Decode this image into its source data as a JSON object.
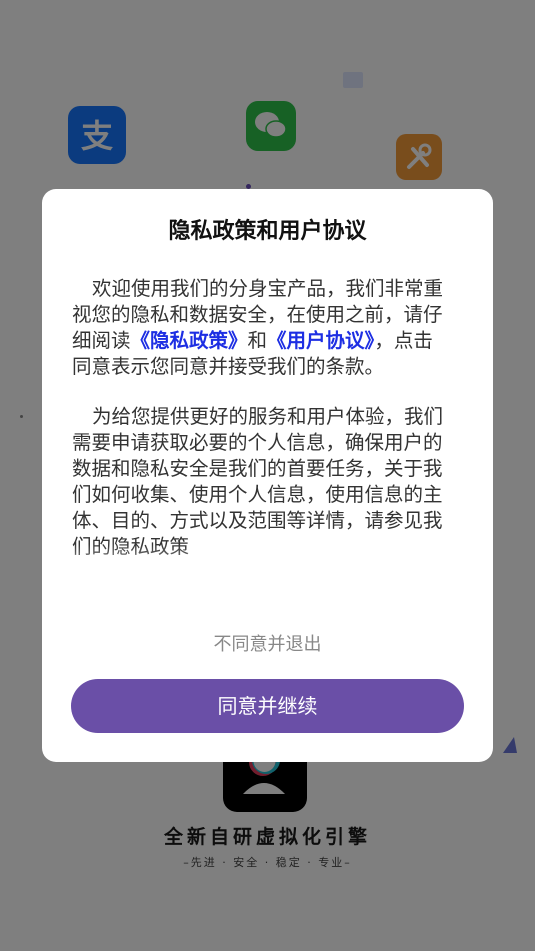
{
  "background": {
    "engine_title": "全新自研虚拟化引擎",
    "engine_subtitle": "–先进 · 安全 · 稳定 · 专业–",
    "icons": [
      "alipay-icon",
      "wechat-icon",
      "tool-icon",
      "app-logo-icon"
    ]
  },
  "dialog": {
    "title": "隐私政策和用户协议",
    "p1_a": "欢迎使用我们的分身宝产品，我们非常重视您的隐私和数据安全，在使用之前，请仔细阅读",
    "privacy_link": "《隐私政策》",
    "and": "和",
    "agreement_link": "《用户协议》",
    "p1_b": "，点击同意表示您同意并接受我们的条款。",
    "p2": "为给您提供更好的服务和用户体验，我们需要申请获取必要的个人信息，确保用户的数据和隐私安全是我们的首要任务，关于我们如何收集、使用个人信息，使用信息的主体、目的、方式以及范围等详情，请参见我们的隐私政策",
    "decline_label": "不同意并退出",
    "agree_label": "同意并继续"
  },
  "colors": {
    "accent": "#6a4fa7",
    "link": "#1d2ee3"
  }
}
